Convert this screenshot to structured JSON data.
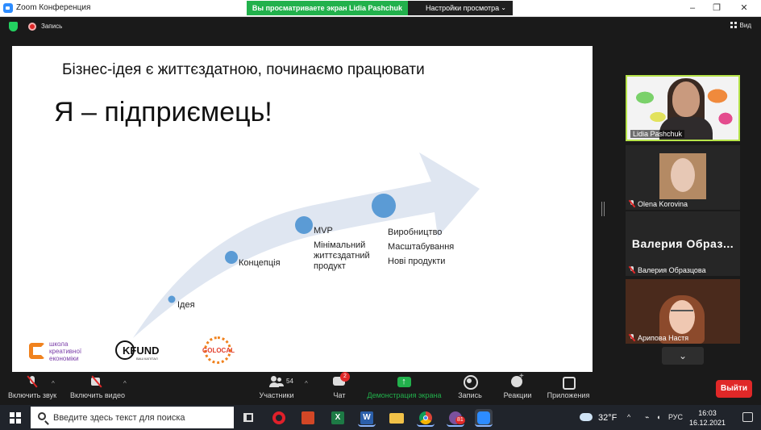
{
  "window": {
    "title": "Zoom Конференция",
    "share_banner": "Вы просматриваете экран Lidia Pashchuk",
    "view_options": "Настройки просмотра",
    "controls": [
      "–",
      "❐",
      "✕"
    ]
  },
  "topbar": {
    "recording_label": "Запись",
    "view_label": "Вид"
  },
  "slide": {
    "heading": "Бізнес-ідея є життєздатною, починаємо працювати",
    "title": "Я – підприємець!",
    "stages": [
      {
        "label": "Ідея"
      },
      {
        "label": "Концепція"
      },
      {
        "label": "MVP"
      },
      {
        "label": "Мінімальний"
      },
      {
        "label": "життєздатний"
      },
      {
        "label": "продукт"
      },
      {
        "label": "Виробництво"
      },
      {
        "label": "Масштабування"
      },
      {
        "label": "Нові продукти"
      }
    ],
    "logos": {
      "school_line1": "школа",
      "school_line2": "креативної",
      "school_line3": "економіки",
      "kfund": "KFUND",
      "kfund_sub": "ВАШ КАПІТАЛ",
      "golocal": "GOLOCAL"
    },
    "colors": {
      "arrow": "#dfe6f1",
      "dots": "#5b9bd5"
    }
  },
  "participants": [
    {
      "name": "Lidia Pashchuk",
      "muted": false,
      "active": true
    },
    {
      "name": "Olena Korovina",
      "muted": true
    },
    {
      "name": "Валерия Образцова",
      "muted": true,
      "display_text": "Валерия  Образ..."
    },
    {
      "name": "Арипова Настя",
      "muted": true
    }
  ],
  "toolbar": {
    "mic_label": "Включить звук",
    "video_label": "Включить видео",
    "participants_label": "Участники",
    "participants_count": "54",
    "chat_label": "Чат",
    "chat_badge": "2",
    "share_label": "Демонстрация экрана",
    "record_label": "Запись",
    "reactions_label": "Реакции",
    "apps_label": "Приложения",
    "leave_label": "Выйти",
    "colors": {
      "share_green": "#22b14c",
      "leave_red": "#e02828"
    }
  },
  "taskbar": {
    "search_placeholder": "Введите здесь текст для поиска",
    "apps": [
      "task-view",
      "opera",
      "powerpoint-like",
      "excel",
      "word",
      "file-explorer",
      "chrome",
      "viber",
      "zoom"
    ],
    "viber_badge": "81",
    "weather": "32°F",
    "language": "РУС",
    "time": "16:03",
    "date": "16.12.2021"
  }
}
